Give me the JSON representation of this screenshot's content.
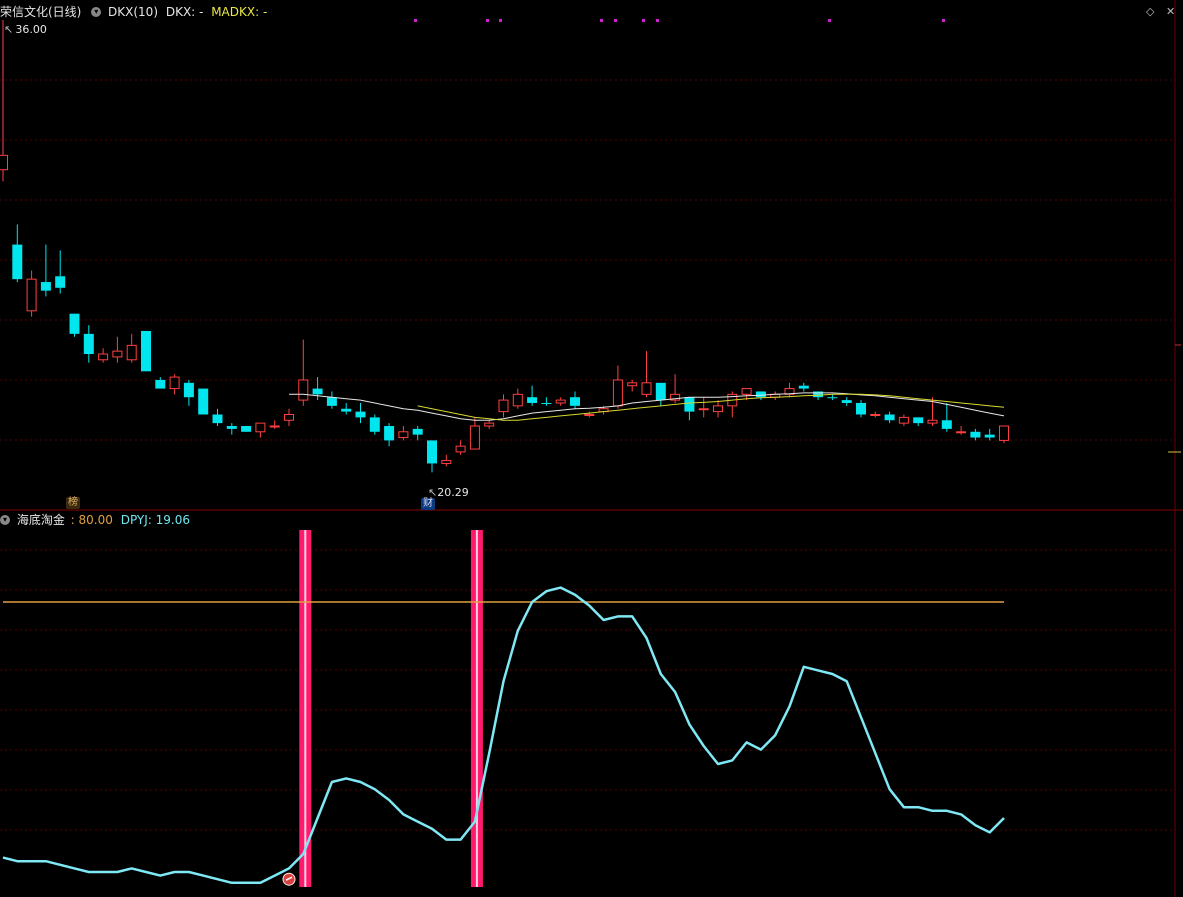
{
  "top_panel": {
    "stock_title": "荣信文化(日线)",
    "indicator_name": "DKX(10)",
    "dkx_label": "DKX: -",
    "madkx_label": "MADKX: -",
    "high_label": "36.00",
    "low_label": "20.29",
    "badge_bang": "榜",
    "badge_cai": "财"
  },
  "bottom_panel": {
    "indicator_name": "海底淘金",
    "line1_label": ": 80.00",
    "line2_label": "DPYJ: 19.06"
  },
  "colors": {
    "up": "#ff4040",
    "down": "#00e5ee",
    "dkx": "#e8e8e8",
    "madkx": "#d8d830",
    "grid": "#5a0000",
    "level": "#e0a040",
    "dpyj": "#7ee8f5",
    "signal": "#ff1a6e"
  },
  "icons": {
    "collapse": "chevron-down-icon",
    "diamond": "diamond-icon",
    "close": "close-icon"
  },
  "chart_data": [
    {
      "type": "candlestick",
      "title": "荣信文化(日线)",
      "candles": [
        {
          "o": 30.8,
          "h": 36.0,
          "l": 30.4,
          "c": 31.3,
          "dir": "up"
        },
        {
          "o": 28.2,
          "h": 28.9,
          "l": 26.9,
          "c": 27.0,
          "dir": "down"
        },
        {
          "o": 25.9,
          "h": 27.3,
          "l": 25.7,
          "c": 27.0,
          "dir": "up"
        },
        {
          "o": 26.9,
          "h": 28.2,
          "l": 26.4,
          "c": 26.6,
          "dir": "down"
        },
        {
          "o": 27.1,
          "h": 28.0,
          "l": 26.5,
          "c": 26.7,
          "dir": "down"
        },
        {
          "o": 25.8,
          "h": 25.8,
          "l": 25.0,
          "c": 25.1,
          "dir": "down"
        },
        {
          "o": 25.1,
          "h": 25.4,
          "l": 24.1,
          "c": 24.4,
          "dir": "down"
        },
        {
          "o": 24.2,
          "h": 24.6,
          "l": 24.1,
          "c": 24.4,
          "dir": "up"
        },
        {
          "o": 24.3,
          "h": 25.0,
          "l": 24.1,
          "c": 24.5,
          "dir": "up"
        },
        {
          "o": 24.2,
          "h": 25.1,
          "l": 24.1,
          "c": 24.7,
          "dir": "up"
        },
        {
          "o": 25.2,
          "h": 25.2,
          "l": 23.8,
          "c": 23.8,
          "dir": "down"
        },
        {
          "o": 23.5,
          "h": 23.6,
          "l": 23.2,
          "c": 23.2,
          "dir": "down"
        },
        {
          "o": 23.2,
          "h": 23.7,
          "l": 23.0,
          "c": 23.6,
          "dir": "up"
        },
        {
          "o": 23.4,
          "h": 23.5,
          "l": 22.6,
          "c": 22.9,
          "dir": "down"
        },
        {
          "o": 23.2,
          "h": 23.2,
          "l": 22.3,
          "c": 22.3,
          "dir": "down"
        },
        {
          "o": 22.3,
          "h": 22.5,
          "l": 21.9,
          "c": 22.0,
          "dir": "down"
        },
        {
          "o": 21.9,
          "h": 22.0,
          "l": 21.6,
          "c": 21.8,
          "dir": "down"
        },
        {
          "o": 21.7,
          "h": 21.9,
          "l": 21.7,
          "c": 21.9,
          "dir": "down"
        },
        {
          "o": 21.7,
          "h": 22.0,
          "l": 21.5,
          "c": 22.0,
          "dir": "up"
        },
        {
          "o": 21.9,
          "h": 22.1,
          "l": 21.8,
          "c": 21.9,
          "dir": "up"
        },
        {
          "o": 22.1,
          "h": 22.5,
          "l": 21.9,
          "c": 22.3,
          "dir": "up"
        },
        {
          "o": 22.8,
          "h": 24.9,
          "l": 22.6,
          "c": 23.5,
          "dir": "up"
        },
        {
          "o": 23.2,
          "h": 23.6,
          "l": 22.8,
          "c": 23.0,
          "dir": "down"
        },
        {
          "o": 22.9,
          "h": 23.1,
          "l": 22.5,
          "c": 22.6,
          "dir": "down"
        },
        {
          "o": 22.5,
          "h": 22.7,
          "l": 22.3,
          "c": 22.4,
          "dir": "down"
        },
        {
          "o": 22.4,
          "h": 22.7,
          "l": 22.0,
          "c": 22.2,
          "dir": "down"
        },
        {
          "o": 22.2,
          "h": 22.3,
          "l": 21.6,
          "c": 21.7,
          "dir": "down"
        },
        {
          "o": 21.9,
          "h": 22.0,
          "l": 21.2,
          "c": 21.4,
          "dir": "down"
        },
        {
          "o": 21.5,
          "h": 21.9,
          "l": 21.4,
          "c": 21.7,
          "dir": "up"
        },
        {
          "o": 21.8,
          "h": 21.9,
          "l": 21.4,
          "c": 21.6,
          "dir": "down"
        },
        {
          "o": 21.4,
          "h": 21.4,
          "l": 20.29,
          "c": 20.6,
          "dir": "down"
        },
        {
          "o": 20.6,
          "h": 20.9,
          "l": 20.5,
          "c": 20.7,
          "dir": "up"
        },
        {
          "o": 21.0,
          "h": 21.4,
          "l": 20.9,
          "c": 21.2,
          "dir": "up"
        },
        {
          "o": 21.1,
          "h": 22.2,
          "l": 21.1,
          "c": 21.9,
          "dir": "up"
        },
        {
          "o": 21.9,
          "h": 22.1,
          "l": 21.8,
          "c": 22.0,
          "dir": "up"
        },
        {
          "o": 22.4,
          "h": 23.0,
          "l": 22.2,
          "c": 22.8,
          "dir": "up"
        },
        {
          "o": 22.6,
          "h": 23.2,
          "l": 22.5,
          "c": 23.0,
          "dir": "up"
        },
        {
          "o": 22.9,
          "h": 23.3,
          "l": 22.6,
          "c": 22.7,
          "dir": "down"
        },
        {
          "o": 22.7,
          "h": 22.9,
          "l": 22.6,
          "c": 22.7,
          "dir": "down"
        },
        {
          "o": 22.7,
          "h": 22.9,
          "l": 22.6,
          "c": 22.8,
          "dir": "up"
        },
        {
          "o": 22.9,
          "h": 23.1,
          "l": 22.5,
          "c": 22.6,
          "dir": "down"
        },
        {
          "o": 22.3,
          "h": 22.4,
          "l": 22.2,
          "c": 22.3,
          "dir": "up"
        },
        {
          "o": 22.4,
          "h": 22.6,
          "l": 22.3,
          "c": 22.5,
          "dir": "up"
        },
        {
          "o": 22.6,
          "h": 24.0,
          "l": 22.5,
          "c": 23.5,
          "dir": "up"
        },
        {
          "o": 23.3,
          "h": 23.5,
          "l": 23.1,
          "c": 23.4,
          "dir": "up"
        },
        {
          "o": 23.0,
          "h": 24.5,
          "l": 22.9,
          "c": 23.4,
          "dir": "up"
        },
        {
          "o": 23.4,
          "h": 23.4,
          "l": 22.6,
          "c": 22.8,
          "dir": "down"
        },
        {
          "o": 22.8,
          "h": 23.7,
          "l": 22.7,
          "c": 23.0,
          "dir": "up"
        },
        {
          "o": 22.9,
          "h": 22.9,
          "l": 22.1,
          "c": 22.4,
          "dir": "down"
        },
        {
          "o": 22.5,
          "h": 22.9,
          "l": 22.2,
          "c": 22.5,
          "dir": "up"
        },
        {
          "o": 22.4,
          "h": 22.8,
          "l": 22.2,
          "c": 22.6,
          "dir": "up"
        },
        {
          "o": 22.6,
          "h": 23.1,
          "l": 22.2,
          "c": 23.0,
          "dir": "up"
        },
        {
          "o": 23.0,
          "h": 23.2,
          "l": 22.8,
          "c": 23.2,
          "dir": "up"
        },
        {
          "o": 23.1,
          "h": 23.1,
          "l": 22.8,
          "c": 22.9,
          "dir": "down"
        },
        {
          "o": 22.9,
          "h": 23.1,
          "l": 22.8,
          "c": 23.0,
          "dir": "up"
        },
        {
          "o": 23.0,
          "h": 23.4,
          "l": 22.9,
          "c": 23.2,
          "dir": "up"
        },
        {
          "o": 23.3,
          "h": 23.4,
          "l": 23.1,
          "c": 23.2,
          "dir": "down"
        },
        {
          "o": 23.1,
          "h": 23.1,
          "l": 22.8,
          "c": 22.9,
          "dir": "down"
        },
        {
          "o": 22.9,
          "h": 23.0,
          "l": 22.8,
          "c": 22.9,
          "dir": "down"
        },
        {
          "o": 22.8,
          "h": 22.9,
          "l": 22.6,
          "c": 22.7,
          "dir": "down"
        },
        {
          "o": 22.7,
          "h": 22.8,
          "l": 22.2,
          "c": 22.3,
          "dir": "down"
        },
        {
          "o": 22.3,
          "h": 22.4,
          "l": 22.2,
          "c": 22.3,
          "dir": "up"
        },
        {
          "o": 22.3,
          "h": 22.4,
          "l": 22.0,
          "c": 22.1,
          "dir": "down"
        },
        {
          "o": 22.0,
          "h": 22.3,
          "l": 21.9,
          "c": 22.2,
          "dir": "up"
        },
        {
          "o": 22.2,
          "h": 22.2,
          "l": 21.9,
          "c": 22.0,
          "dir": "down"
        },
        {
          "o": 22.0,
          "h": 22.9,
          "l": 21.9,
          "c": 22.1,
          "dir": "up"
        },
        {
          "o": 22.1,
          "h": 22.7,
          "l": 21.7,
          "c": 21.8,
          "dir": "down"
        },
        {
          "o": 21.7,
          "h": 21.9,
          "l": 21.6,
          "c": 21.7,
          "dir": "up"
        },
        {
          "o": 21.7,
          "h": 21.8,
          "l": 21.4,
          "c": 21.5,
          "dir": "down"
        },
        {
          "o": 21.6,
          "h": 21.8,
          "l": 21.4,
          "c": 21.5,
          "dir": "down"
        },
        {
          "o": 21.4,
          "h": 21.9,
          "l": 21.3,
          "c": 21.9,
          "dir": "up"
        }
      ],
      "dkx": {
        "start_index": 20,
        "values": [
          23.0,
          23.0,
          22.95,
          22.9,
          22.85,
          22.8,
          22.7,
          22.6,
          22.5,
          22.45,
          22.35,
          22.25,
          22.15,
          22.1,
          22.1,
          22.15,
          22.25,
          22.35,
          22.4,
          22.45,
          22.5,
          22.52,
          22.55,
          22.6,
          22.7,
          22.75,
          22.8,
          22.85,
          22.9,
          22.9,
          22.9,
          22.92,
          22.95,
          22.97,
          23.0,
          23.02,
          23.05,
          23.05,
          23.05,
          23.02,
          22.98,
          22.95,
          22.9,
          22.85,
          22.8,
          22.75,
          22.65,
          22.55,
          22.45,
          22.35,
          22.25
        ]
      },
      "madkx": {
        "start_index": 29,
        "values": [
          22.6,
          22.5,
          22.4,
          22.3,
          22.2,
          22.15,
          22.1,
          22.1,
          22.15,
          22.2,
          22.25,
          22.3,
          22.35,
          22.4,
          22.45,
          22.5,
          22.55,
          22.6,
          22.65,
          22.7,
          22.72,
          22.75,
          22.8,
          22.85,
          22.88,
          22.9,
          22.92,
          22.95,
          22.97,
          23.0,
          23.0,
          23.0,
          22.98,
          22.95,
          22.9,
          22.85,
          22.8,
          22.75,
          22.7,
          22.65,
          22.6,
          22.55
        ]
      }
    },
    {
      "type": "line",
      "series": [
        {
          "name": "DPYJ",
          "values": [
            9,
            8,
            8,
            8,
            7,
            6,
            5,
            5,
            5,
            6,
            5,
            4,
            5,
            5,
            4,
            3,
            2,
            2,
            2,
            4,
            6,
            10,
            20,
            30,
            31,
            30,
            28,
            25,
            21,
            19,
            17,
            14,
            14,
            19,
            38,
            58,
            72,
            80,
            83,
            84,
            82,
            79,
            75,
            76,
            76,
            70,
            60,
            55,
            46,
            40,
            35,
            36,
            41,
            39,
            43,
            51,
            62,
            61,
            60,
            58,
            48,
            38,
            28,
            23,
            23,
            22,
            22,
            21,
            18,
            16,
            20
          ]
        },
        {
          "name": "",
          "values": [
            80,
            80,
            80,
            80,
            80,
            80,
            80,
            80,
            80,
            80,
            80,
            80,
            80,
            80,
            80,
            80,
            80,
            80,
            80,
            80,
            80,
            80,
            80,
            80,
            80,
            80,
            80,
            80,
            80,
            80,
            80,
            80,
            80,
            80,
            80,
            80,
            80,
            80,
            80,
            80,
            80,
            80,
            80,
            80,
            80,
            80,
            80,
            80,
            80,
            80,
            80,
            80,
            80,
            80,
            80,
            80,
            80,
            80,
            80,
            80,
            80,
            80,
            80,
            80,
            80,
            80,
            80,
            80,
            80,
            80,
            80
          ]
        }
      ],
      "signal_bars_index": [
        21,
        33
      ]
    }
  ]
}
